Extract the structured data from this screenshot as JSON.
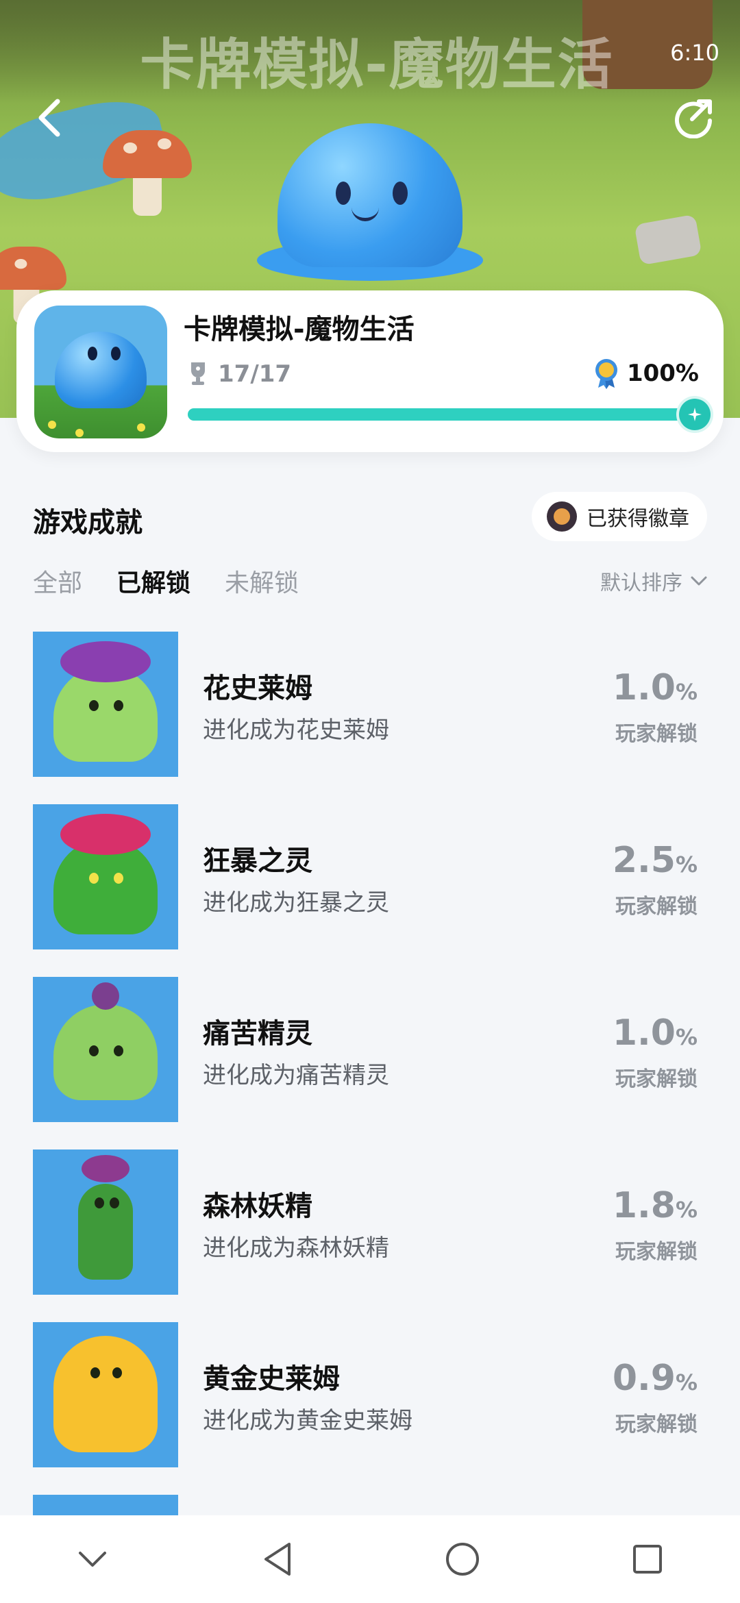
{
  "header": {
    "overlay_title": "卡牌模拟-魔物生活",
    "status_time": "6:10"
  },
  "game": {
    "name": "卡牌模拟-魔物生活",
    "achievements_count": "17/17",
    "completion": "100%",
    "completion_fraction": 1.0,
    "accent_color": "#2ed0c0"
  },
  "section": {
    "title": "游戏成就",
    "badge_button": "已获得徽章"
  },
  "tabs": [
    {
      "label": "全部",
      "active": false
    },
    {
      "label": "已解锁",
      "active": true
    },
    {
      "label": "未解锁",
      "active": false
    }
  ],
  "sort": {
    "label": "默认排序"
  },
  "achievements": [
    {
      "name": "花史莱姆",
      "desc": "进化成为花史莱姆",
      "pct": "1.0",
      "unit": "%",
      "pct_label": "玩家解锁"
    },
    {
      "name": "狂暴之灵",
      "desc": "进化成为狂暴之灵",
      "pct": "2.5",
      "unit": "%",
      "pct_label": "玩家解锁"
    },
    {
      "name": "痛苦精灵",
      "desc": "进化成为痛苦精灵",
      "pct": "1.0",
      "unit": "%",
      "pct_label": "玩家解锁"
    },
    {
      "name": "森林妖精",
      "desc": "进化成为森林妖精",
      "pct": "1.8",
      "unit": "%",
      "pct_label": "玩家解锁"
    },
    {
      "name": "黄金史莱姆",
      "desc": "进化成为黄金史莱姆",
      "pct": "0.9",
      "unit": "%",
      "pct_label": "玩家解锁"
    }
  ]
}
